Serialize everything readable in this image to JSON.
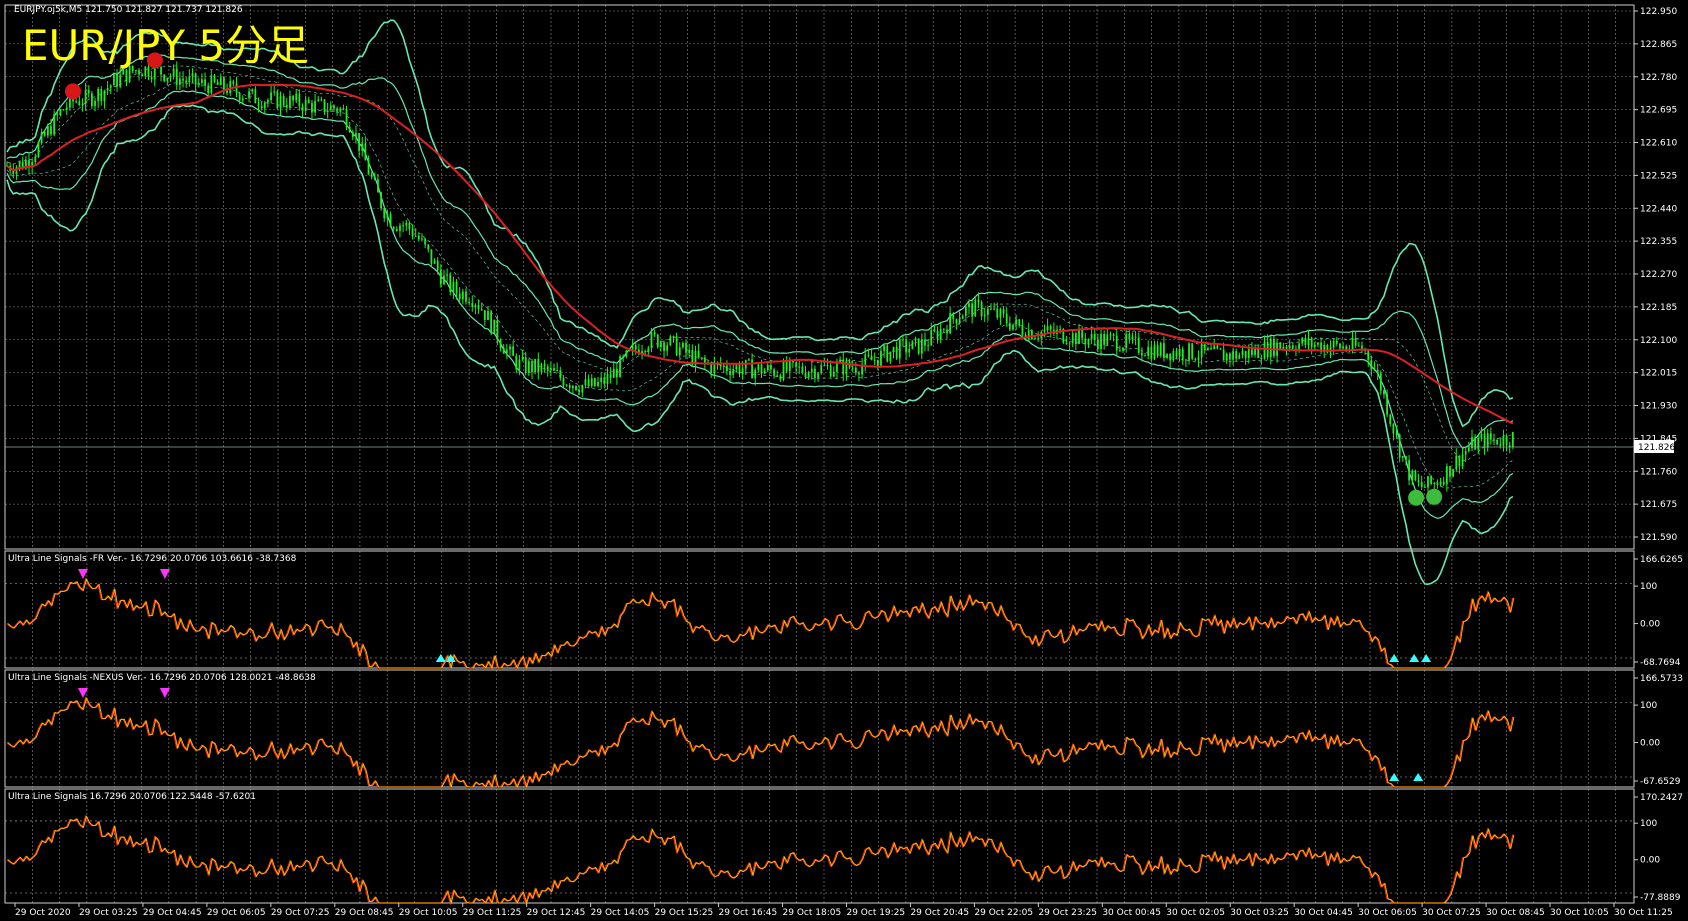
{
  "window": {
    "title_bar": "EURJPY.oj5k,M5  121.750 121.827 121.737 121.826",
    "overlay_title": "EUR/JPY  5分足"
  },
  "colors": {
    "background": "#000000",
    "grid": "#8a8a8a",
    "candles": "#22ee22",
    "bands": "#66e8b0",
    "ma": "#dd2020",
    "osc_line_a": "#ff3300",
    "osc_line_b": "#ffcc00",
    "sell_arrow": "#ff33ff",
    "buy_arrow": "#33ffff"
  },
  "price_axis": {
    "ticks": [
      "122.950",
      "122.865",
      "122.780",
      "122.695",
      "122.610",
      "122.525",
      "122.440",
      "122.355",
      "122.270",
      "122.185",
      "122.100",
      "122.015",
      "121.930",
      "121.845",
      "121.760",
      "121.675",
      "121.590"
    ],
    "current_price": "121.826"
  },
  "time_axis": {
    "labels": [
      "29 Oct 2020",
      "29 Oct 03:25",
      "29 Oct 04:45",
      "29 Oct 06:05",
      "29 Oct 07:25",
      "29 Oct 08:45",
      "29 Oct 10:05",
      "29 Oct 11:25",
      "29 Oct 12:45",
      "29 Oct 14:05",
      "29 Oct 15:25",
      "29 Oct 16:45",
      "29 Oct 18:05",
      "29 Oct 19:25",
      "29 Oct 20:45",
      "29 Oct 22:05",
      "29 Oct 23:25",
      "30 Oct 00:45",
      "30 Oct 02:05",
      "30 Oct 03:25",
      "30 Oct 04:45",
      "30 Oct 06:05",
      "30 Oct 07:25",
      "30 Oct 08:45",
      "30 Oct 10:05",
      "30 Oct 11:25"
    ]
  },
  "subwindows": [
    {
      "label": "Ultra Line Signals -FR Ver.- 16.7296 20.0706 103.6616 -38.7368",
      "scale": [
        "166.6265",
        "100",
        "0.00",
        "-68.7694"
      ]
    },
    {
      "label": "Ultra Line Signals -NEXUS Ver.- 16.7296 20.0706 128.0021 -48.8638",
      "scale": [
        "166.5733",
        "100",
        "0.00",
        "-67.6529"
      ]
    },
    {
      "label": "Ultra Line Signals 16.7296 20.0706 122.5448 -57.6201",
      "scale": [
        "170.2427",
        "100",
        "0.00",
        "-77.8889"
      ]
    }
  ],
  "chart_data": {
    "type": "candlestick",
    "symbol": "EURJPY",
    "timeframe": "M5",
    "ylim": [
      121.59,
      122.95
    ],
    "close_path": [
      [
        "29 Oct 2020",
        122.55
      ],
      [
        "29 Oct 03:25",
        122.72
      ],
      [
        "29 Oct 04:45",
        122.8
      ],
      [
        "29 Oct 06:05",
        122.76
      ],
      [
        "29 Oct 07:25",
        122.72
      ],
      [
        "29 Oct 08:45",
        122.7
      ],
      [
        "29 Oct 10:05",
        122.4
      ],
      [
        "29 Oct 11:25",
        122.22
      ],
      [
        "29 Oct 12:45",
        122.03
      ],
      [
        "29 Oct 14:05",
        121.98
      ],
      [
        "29 Oct 15:25",
        122.1
      ],
      [
        "29 Oct 16:45",
        122.03
      ],
      [
        "29 Oct 18:05",
        122.02
      ],
      [
        "29 Oct 19:25",
        122.03
      ],
      [
        "29 Oct 20:45",
        122.08
      ],
      [
        "29 Oct 22:05",
        122.18
      ],
      [
        "29 Oct 23:25",
        122.12
      ],
      [
        "30 Oct 00:45",
        122.1
      ],
      [
        "30 Oct 02:05",
        122.07
      ],
      [
        "30 Oct 03:25",
        122.06
      ],
      [
        "30 Oct 04:45",
        122.09
      ],
      [
        "30 Oct 06:05",
        122.08
      ],
      [
        "30 Oct 07:25",
        121.72
      ],
      [
        "30 Oct 08:45",
        121.84
      ],
      [
        "30 Oct 10:05",
        121.86
      ],
      [
        "30 Oct 11:25",
        121.83
      ]
    ],
    "signals": [
      {
        "window": "main",
        "type": "sell",
        "time": "29 Oct 03:25"
      },
      {
        "window": "main",
        "type": "sell",
        "time": "29 Oct 04:45"
      },
      {
        "window": "main",
        "type": "buy",
        "time": "30 Oct 07:25"
      },
      {
        "window": "main",
        "type": "buy",
        "time": "30 Oct 07:25"
      }
    ]
  }
}
